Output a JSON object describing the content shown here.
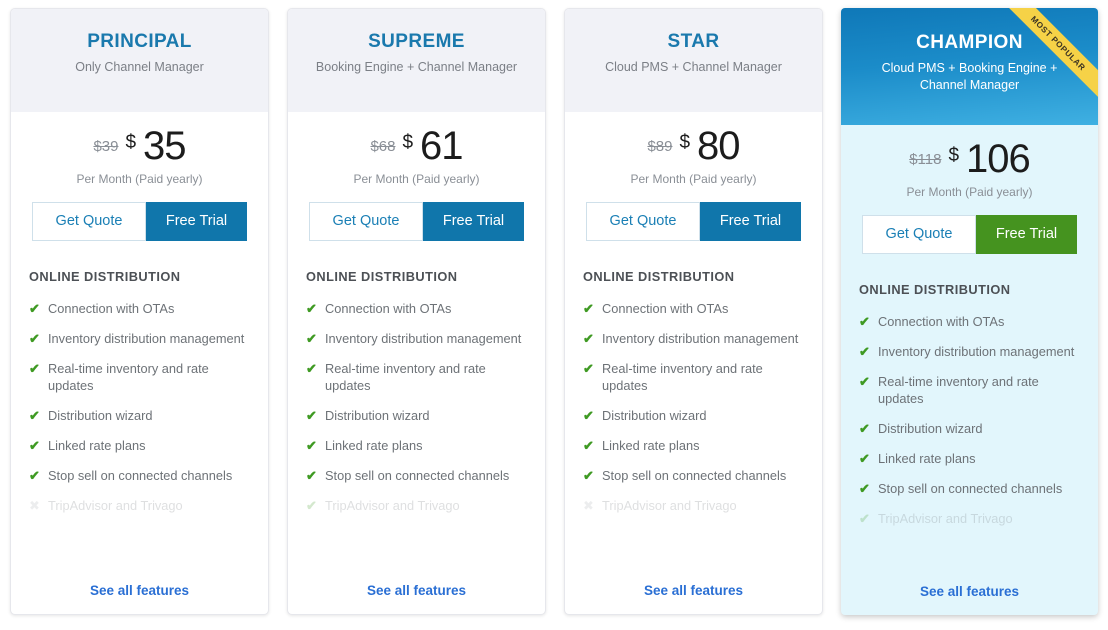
{
  "colors": {
    "accent_blue": "#1a79ad",
    "button_blue": "#1076ab",
    "button_green": "#45931f",
    "ribbon_yellow": "#f6d247",
    "check_green": "#3f9a23",
    "cross_grey": "#aeb2b6",
    "link_blue": "#2a6fd4",
    "card_head_grey": "#f1f2f7",
    "featured_body": "#e2f6fc"
  },
  "labels": {
    "get_quote": "Get Quote",
    "free_trial": "Free Trial",
    "see_all_features": "See all features",
    "features_heading": "ONLINE DISTRIBUTION",
    "price_note": "Per Month (Paid yearly)",
    "currency": "$",
    "ribbon": "MOST POPULAR"
  },
  "plans": [
    {
      "name": "PRINCIPAL",
      "subtitle": "Only Channel Manager",
      "old_price": "$39",
      "price": "35",
      "featured": false,
      "features": [
        {
          "label": "Connection with OTAs",
          "icon": "check",
          "faded": false
        },
        {
          "label": "Inventory distribution management",
          "icon": "check",
          "faded": false
        },
        {
          "label": "Real-time inventory and rate updates",
          "icon": "check",
          "faded": false
        },
        {
          "label": "Distribution wizard",
          "icon": "check",
          "faded": false
        },
        {
          "label": "Linked rate plans",
          "icon": "check",
          "faded": false
        },
        {
          "label": "Stop sell on connected channels",
          "icon": "check",
          "faded": false
        },
        {
          "label": "TripAdvisor and Trivago",
          "icon": "cross",
          "faded": true
        }
      ]
    },
    {
      "name": "SUPREME",
      "subtitle": "Booking Engine + Channel Manager",
      "old_price": "$68",
      "price": "61",
      "featured": false,
      "features": [
        {
          "label": "Connection with OTAs",
          "icon": "check",
          "faded": false
        },
        {
          "label": "Inventory distribution management",
          "icon": "check",
          "faded": false
        },
        {
          "label": "Real-time inventory and rate updates",
          "icon": "check",
          "faded": false
        },
        {
          "label": "Distribution wizard",
          "icon": "check",
          "faded": false
        },
        {
          "label": "Linked rate plans",
          "icon": "check",
          "faded": false
        },
        {
          "label": "Stop sell on connected channels",
          "icon": "check",
          "faded": false
        },
        {
          "label": "TripAdvisor and Trivago",
          "icon": "check",
          "faded": true
        }
      ]
    },
    {
      "name": "STAR",
      "subtitle": "Cloud PMS + Channel Manager",
      "old_price": "$89",
      "price": "80",
      "featured": false,
      "features": [
        {
          "label": "Connection with OTAs",
          "icon": "check",
          "faded": false
        },
        {
          "label": "Inventory distribution management",
          "icon": "check",
          "faded": false
        },
        {
          "label": "Real-time inventory and rate updates",
          "icon": "check",
          "faded": false
        },
        {
          "label": "Distribution wizard",
          "icon": "check",
          "faded": false
        },
        {
          "label": "Linked rate plans",
          "icon": "check",
          "faded": false
        },
        {
          "label": "Stop sell on connected channels",
          "icon": "check",
          "faded": false
        },
        {
          "label": "TripAdvisor and Trivago",
          "icon": "cross",
          "faded": true
        }
      ]
    },
    {
      "name": "CHAMPION",
      "subtitle": "Cloud PMS + Booking Engine + Channel Manager",
      "old_price": "$118",
      "price": "106",
      "featured": true,
      "features": [
        {
          "label": "Connection with OTAs",
          "icon": "check",
          "faded": false
        },
        {
          "label": "Inventory distribution management",
          "icon": "check",
          "faded": false
        },
        {
          "label": "Real-time inventory and rate updates",
          "icon": "check",
          "faded": false
        },
        {
          "label": "Distribution wizard",
          "icon": "check",
          "faded": false
        },
        {
          "label": "Linked rate plans",
          "icon": "check",
          "faded": false
        },
        {
          "label": "Stop sell on connected channels",
          "icon": "check",
          "faded": false
        },
        {
          "label": "TripAdvisor and Trivago",
          "icon": "check",
          "faded": true
        }
      ]
    }
  ]
}
